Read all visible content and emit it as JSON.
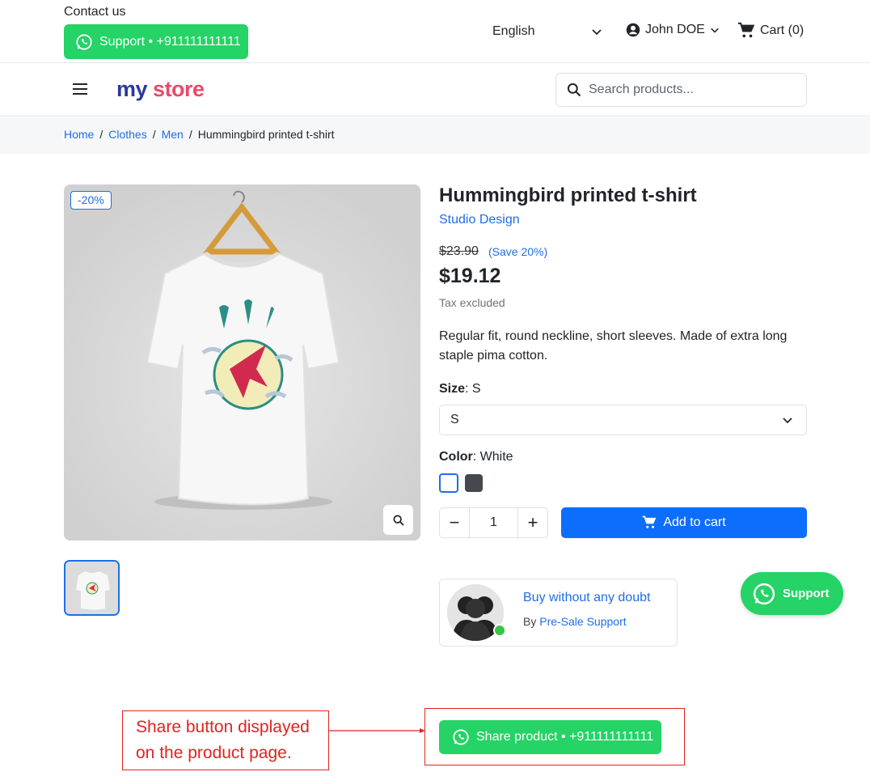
{
  "header": {
    "contact": "Contact us",
    "support_btn": "Support • +911111111111",
    "language": "English",
    "user": "John DOE",
    "cart": "Cart (0)"
  },
  "nav": {
    "logo_my": "my",
    "logo_store": "store",
    "search_placeholder": "Search products..."
  },
  "breadcrumb": {
    "items": [
      "Home",
      "Clothes",
      "Men"
    ],
    "separator": "/",
    "current": "Hummingbird printed t-shirt"
  },
  "product": {
    "discount_badge": "-20%",
    "title": "Hummingbird printed t-shirt",
    "brand": "Studio Design",
    "old_price": "$23.90",
    "save": "(Save 20%)",
    "price": "$19.12",
    "tax": "Tax excluded",
    "description": "Regular fit, round neckline, short sleeves. Made of extra long staple pima cotton.",
    "size_label": "Size",
    "size_value": "S",
    "size_selected": "S",
    "color_label": "Color",
    "color_value": "White",
    "colors": [
      "#ffffff",
      "#45494f"
    ],
    "quantity": "1",
    "add_to_cart": "Add to cart"
  },
  "support_card": {
    "title": "Buy without any doubt",
    "by": "By",
    "by_link": "Pre-Sale Support"
  },
  "floating_support": "Support",
  "annotation": {
    "line1": "Share button displayed",
    "line2": "on the product page."
  },
  "share_btn": "Share product • +911111111111",
  "colors": {
    "whatsapp": "#25d366",
    "primary": "#0d6efd",
    "link": "#1f6ee5",
    "annotation": "#e0231f"
  }
}
